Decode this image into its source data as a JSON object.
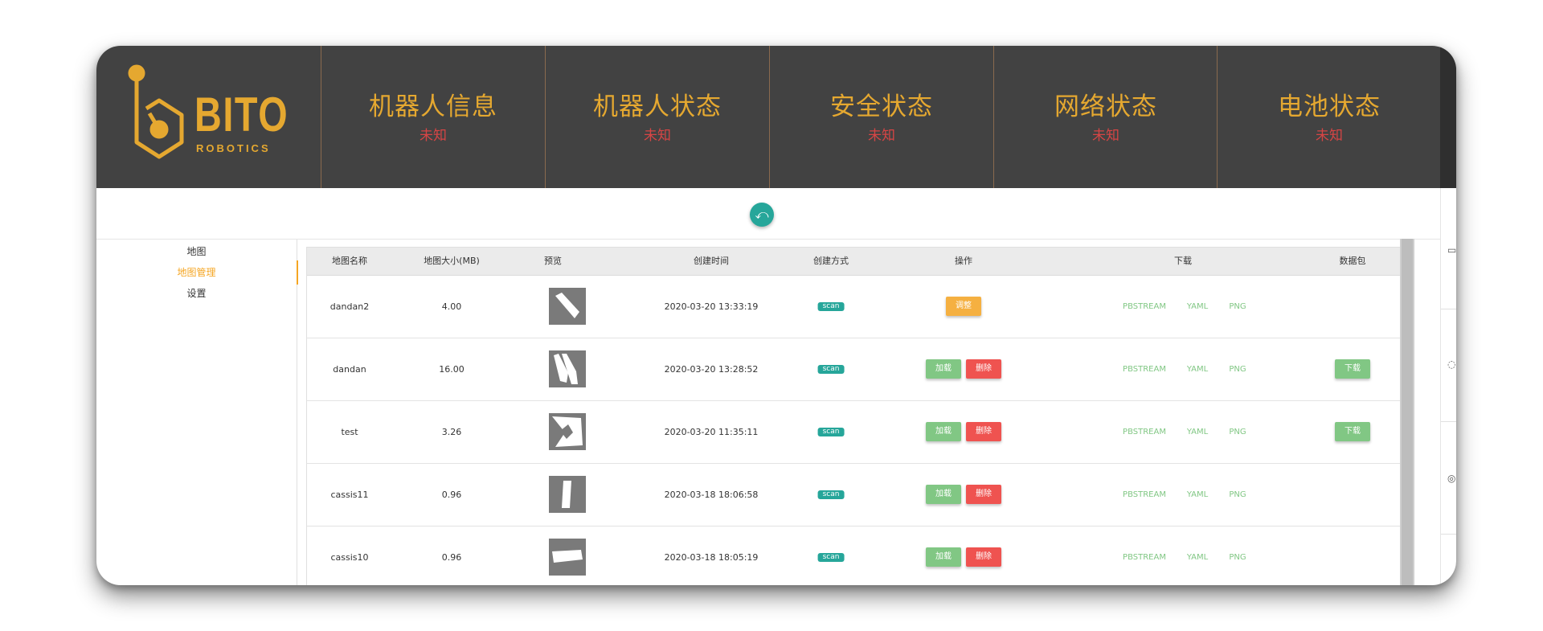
{
  "brand": {
    "name": "BITO",
    "sub": "ROBOTICS",
    "accent": "#e5a830"
  },
  "status_panels": [
    {
      "title": "机器人信息",
      "value": "未知"
    },
    {
      "title": "机器人状态",
      "value": "未知"
    },
    {
      "title": "安全状态",
      "value": "未知"
    },
    {
      "title": "网络状态",
      "value": "未知"
    },
    {
      "title": "电池状态",
      "value": "未知"
    }
  ],
  "collapse_icon": "undo-icon",
  "sidebar": {
    "items": [
      {
        "label": "地图"
      },
      {
        "label": "地图管理",
        "active": true
      },
      {
        "label": "设置"
      }
    ]
  },
  "table": {
    "headers": [
      "地图名称",
      "地图大小(MB)",
      "预览",
      "创建时间",
      "创建方式",
      "操作",
      "下载",
      "数据包"
    ],
    "rows": [
      {
        "name": "dandan2",
        "size": "4.00",
        "time": "2020-03-20 13:33:19",
        "method": "scan",
        "actions": [
          "调整"
        ],
        "downloads": [
          "PBSTREAM",
          "YAML",
          "PNG"
        ],
        "package": ""
      },
      {
        "name": "dandan",
        "size": "16.00",
        "time": "2020-03-20 13:28:52",
        "method": "scan",
        "actions": [
          "加载",
          "删除"
        ],
        "downloads": [
          "PBSTREAM",
          "YAML",
          "PNG"
        ],
        "package": "下载"
      },
      {
        "name": "test",
        "size": "3.26",
        "time": "2020-03-20 11:35:11",
        "method": "scan",
        "actions": [
          "加载",
          "删除"
        ],
        "downloads": [
          "PBSTREAM",
          "YAML",
          "PNG"
        ],
        "package": "下载"
      },
      {
        "name": "cassis11",
        "size": "0.96",
        "time": "2020-03-18 18:06:58",
        "method": "scan",
        "actions": [
          "加载",
          "删除"
        ],
        "downloads": [
          "PBSTREAM",
          "YAML",
          "PNG"
        ],
        "package": ""
      },
      {
        "name": "cassis10",
        "size": "0.96",
        "time": "2020-03-18 18:05:19",
        "method": "scan",
        "actions": [
          "加载",
          "删除"
        ],
        "downloads": [
          "PBSTREAM",
          "YAML",
          "PNG"
        ],
        "package": ""
      }
    ]
  }
}
